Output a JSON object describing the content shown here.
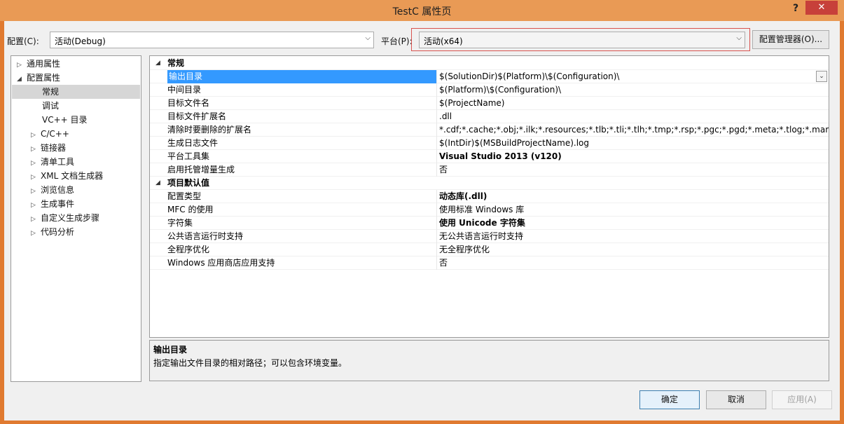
{
  "window": {
    "title": "TestC 属性页",
    "help": "?",
    "close": "✕"
  },
  "config_bar": {
    "config_label": "配置(C):",
    "config_value": "活动(Debug)",
    "platform_label": "平台(P):",
    "platform_value": "活动(x64)",
    "manager_label": "配置管理器(O)..."
  },
  "tree": {
    "items": [
      {
        "label": "通用属性",
        "expander": "▷"
      },
      {
        "label": "配置属性",
        "expander": "◢"
      },
      {
        "label": "常规",
        "expander": ""
      },
      {
        "label": "调试",
        "expander": ""
      },
      {
        "label": "VC++ 目录",
        "expander": ""
      },
      {
        "label": "C/C++",
        "expander": "▷"
      },
      {
        "label": "链接器",
        "expander": "▷"
      },
      {
        "label": "清单工具",
        "expander": "▷"
      },
      {
        "label": "XML 文档生成器",
        "expander": "▷"
      },
      {
        "label": "浏览信息",
        "expander": "▷"
      },
      {
        "label": "生成事件",
        "expander": "▷"
      },
      {
        "label": "自定义生成步骤",
        "expander": "▷"
      },
      {
        "label": "代码分析",
        "expander": "▷"
      }
    ]
  },
  "grid": {
    "cat1": "常规",
    "cat2": "项目默认值",
    "cat_arrow": "◢",
    "dropdown": "⌄",
    "rows1": [
      {
        "name": "输出目录",
        "value": "$(SolutionDir)$(Platform)\\$(Configuration)\\"
      },
      {
        "name": "中间目录",
        "value": "$(Platform)\\$(Configuration)\\"
      },
      {
        "name": "目标文件名",
        "value": "$(ProjectName)"
      },
      {
        "name": "目标文件扩展名",
        "value": ".dll"
      },
      {
        "name": "清除时要删除的扩展名",
        "value": "*.cdf;*.cache;*.obj;*.ilk;*.resources;*.tlb;*.tli;*.tlh;*.tmp;*.rsp;*.pgc;*.pgd;*.meta;*.tlog;*.manifest;*.res"
      },
      {
        "name": "生成日志文件",
        "value": "$(IntDir)$(MSBuildProjectName).log"
      },
      {
        "name": "平台工具集",
        "value": "Visual Studio 2013 (v120)"
      },
      {
        "name": "启用托管增量生成",
        "value": "否"
      }
    ],
    "rows2": [
      {
        "name": "配置类型",
        "value": "动态库(.dll)"
      },
      {
        "name": "MFC 的使用",
        "value": "使用标准 Windows 库"
      },
      {
        "name": "字符集",
        "value": "使用 Unicode 字符集"
      },
      {
        "name": "公共语言运行时支持",
        "value": "无公共语言运行时支持"
      },
      {
        "name": "全程序优化",
        "value": "无全程序优化"
      },
      {
        "name": "Windows 应用商店应用支持",
        "value": "否"
      }
    ]
  },
  "description": {
    "title": "输出目录",
    "text": "指定输出文件目录的相对路径；可以包含环境变量。"
  },
  "buttons": {
    "ok": "确定",
    "cancel": "取消",
    "apply": "应用(A)"
  }
}
